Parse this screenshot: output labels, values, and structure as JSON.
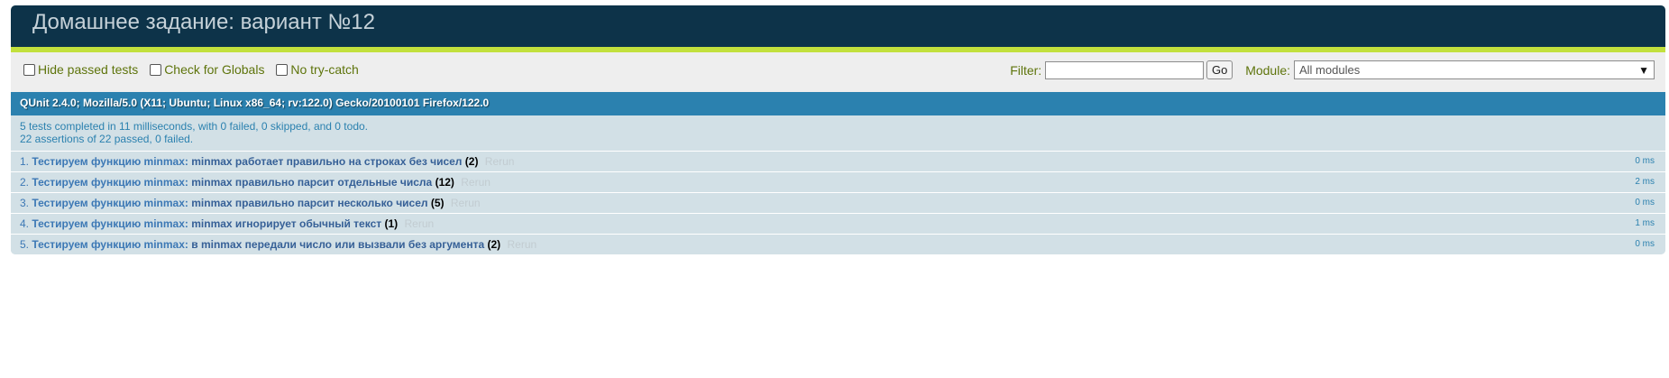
{
  "header": {
    "title": "Домашнее задание: вариант №12"
  },
  "toolbar": {
    "checkboxes": [
      {
        "label": "Hide passed tests",
        "checked": false
      },
      {
        "label": "Check for Globals",
        "checked": false
      },
      {
        "label": "No try-catch",
        "checked": false
      }
    ],
    "filter_label": "Filter:",
    "filter_value": "",
    "go_label": "Go",
    "module_label": "Module:",
    "module_selected": "All modules",
    "module_arrow": "▼"
  },
  "user_agent": "QUnit 2.4.0; Mozilla/5.0 (X11; Ubuntu; Linux x86_64; rv:122.0) Gecko/20100101 Firefox/122.0",
  "result": {
    "line1": "5 tests completed in 11 milliseconds, with 0 failed, 0 skipped, and 0 todo.",
    "line2": "22 assertions of 22 passed, 0 failed."
  },
  "tests": [
    {
      "num": "1.",
      "module": "Тестируем функцию minmax:",
      "name": "minmax работает правильно на строках без чисел",
      "count": "(2)",
      "rerun": "Rerun",
      "runtime": "0 ms"
    },
    {
      "num": "2.",
      "module": "Тестируем функцию minmax:",
      "name": "minmax правильно парсит отдельные числа",
      "count": "(12)",
      "rerun": "Rerun",
      "runtime": "2 ms"
    },
    {
      "num": "3.",
      "module": "Тестируем функцию minmax:",
      "name": "minmax правильно парсит несколько чисел",
      "count": "(5)",
      "rerun": "Rerun",
      "runtime": "0 ms"
    },
    {
      "num": "4.",
      "module": "Тестируем функцию minmax:",
      "name": "minmax игнорирует обычный текст",
      "count": "(1)",
      "rerun": "Rerun",
      "runtime": "1 ms"
    },
    {
      "num": "5.",
      "module": "Тестируем функцию minmax:",
      "name": "в minmax передали число или вызвали без аргумента",
      "count": "(2)",
      "rerun": "Rerun",
      "runtime": "0 ms"
    }
  ],
  "colors": {
    "header_bg": "#0d3349",
    "header_border": "#c2e03d",
    "useragent_bg": "#2b81af",
    "result_bg": "#d2e0e6",
    "toolbar_text": "#5e740b"
  }
}
